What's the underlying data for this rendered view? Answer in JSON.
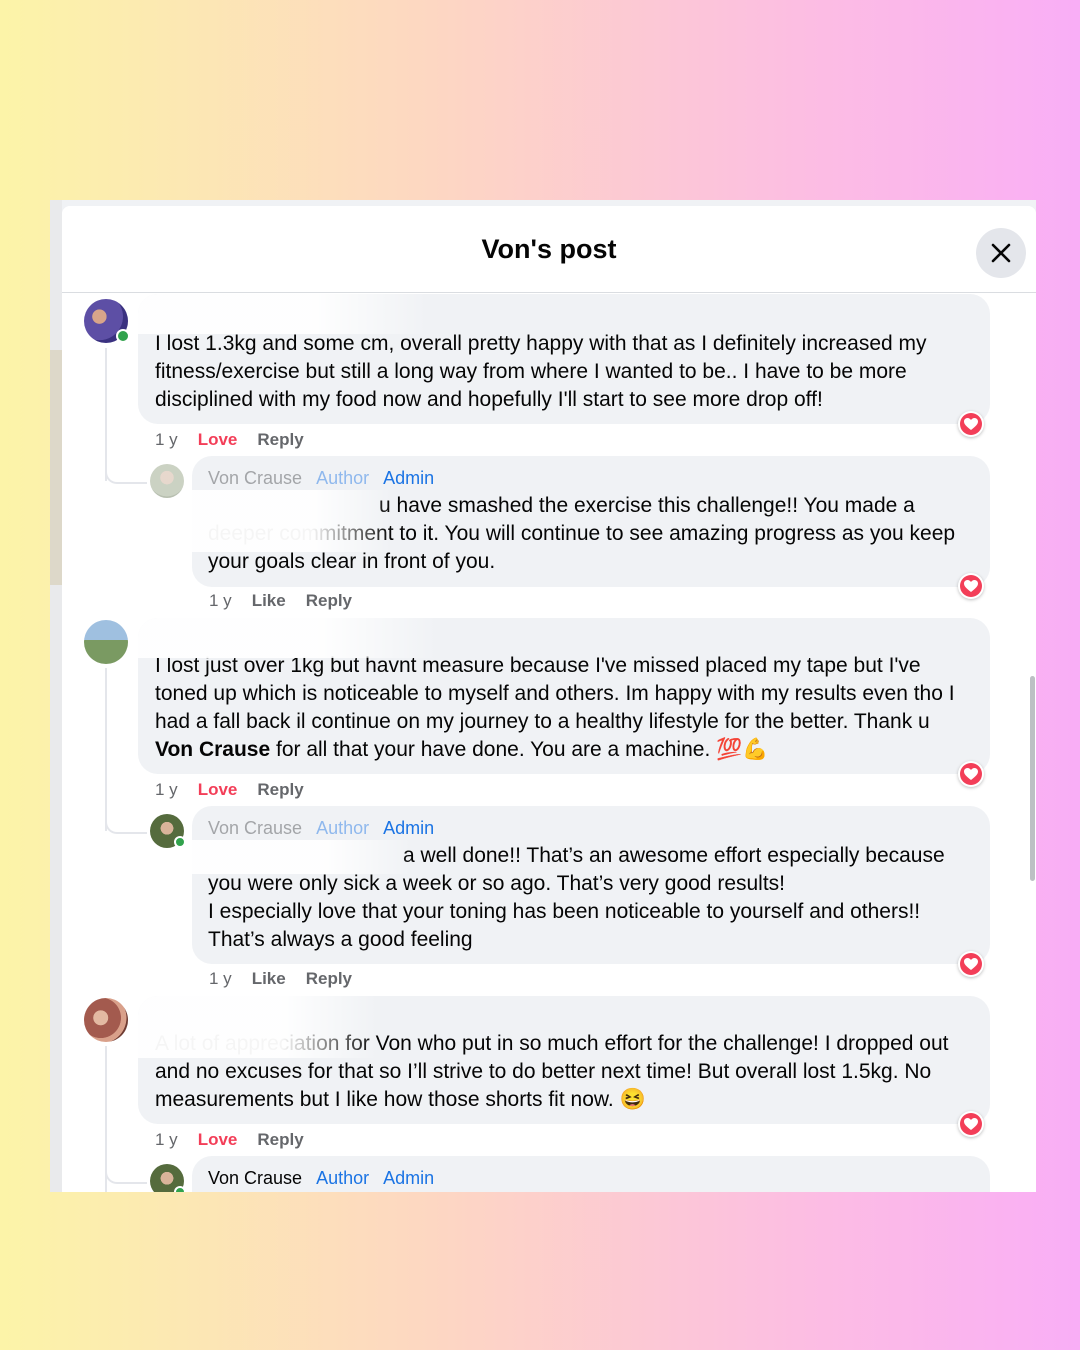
{
  "modal": {
    "title": "Von's post"
  },
  "comments": [
    {
      "text": "I lost 1.3kg and some cm, overall pretty happy with that as I definitely increased my\nfitness/exercise but still a long way from where I wanted to be.. I have to be more\ndisciplined with my food now and hopefully I'll start to see more drop off!",
      "time": "1 y",
      "love": "Love",
      "reply": "Reply",
      "response": {
        "author": "Von Crause",
        "badges": [
          "Author",
          "Admin"
        ],
        "text": "u have smashed the exercise this challenge!! You made a\ndeeper commitment to it. You will continue to see amazing progress as you keep\nyour goals clear in front of you.",
        "time": "1 y",
        "like": "Like",
        "reply": "Reply"
      }
    },
    {
      "text_parts": [
        "I lost just over 1kg but havnt measure because I've missed placed my tape but I've\ntoned up which is noticeable to myself and others. Im happy with my results even tho I\nhad a fall back il continue on my journey to a healthy lifestyle for the better. Thank u\n",
        "Von Crause",
        " for all that your have done. You are a machine. "
      ],
      "emoji": "💯💪",
      "time": "1 y",
      "love": "Love",
      "reply": "Reply",
      "response": {
        "author": "Von Crause",
        "badges": [
          "Author",
          "Admin"
        ],
        "text": "a well done!! That’s an awesome effort especially because\nyou were only sick a week or so ago. That’s very good results!\nI especially love that your toning has been noticeable to yourself and others!!\nThat’s always a good feeling",
        "time": "1 y",
        "like": "Like",
        "reply": "Reply"
      }
    },
    {
      "text": "A lot of appreciation for Von who put in so much effort for the challenge! I dropped out\nand no excuses for that so I’ll strive to do better next time! But overall lost 1.5kg. No\nmeasurements but I like how those shorts fit now. ",
      "emoji": "😆",
      "time": "1 y",
      "love": "Love",
      "reply": "Reply",
      "response": {
        "author": "Von Crause",
        "badges": [
          "Author",
          "Admin"
        ]
      }
    }
  ],
  "colors": {
    "love": "#f33e58",
    "badge": "#1b74e4",
    "bubble": "#f0f2f5",
    "online": "#31a24c"
  },
  "icons": {
    "close": "close-icon",
    "reaction": "heart-icon"
  }
}
